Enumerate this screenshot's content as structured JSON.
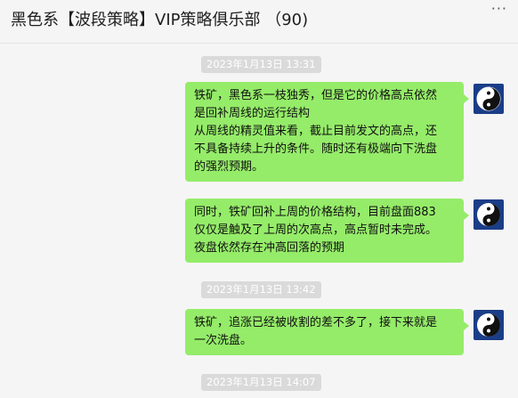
{
  "window": {
    "title": "黑色系【波段策略】VIP策略俱乐部 （90)",
    "more_label": "···"
  },
  "messages": [
    {
      "time": "2023年1月13日 13:31"
    },
    {
      "lines": [
        "铁矿，黑色系一枝独秀，但是它的价格高点依然",
        "是回补周线的运行结构",
        "从周线的精灵值来看，截止目前发文的高点，还",
        "不具备持续上升的条件。随时还有极端向下洗盘",
        "的强烈预期。"
      ]
    },
    {
      "lines": [
        "同时，铁矿回补上周的价格结构，目前盘面883",
        "仅仅是触及了上周的次高点，高点暂时未完成。",
        "夜盘依然存在冲高回落的预期"
      ]
    },
    {
      "time": "2023年1月13日 13:42"
    },
    {
      "lines": [
        "铁矿，追涨已经被收割的差不多了，接下来就是",
        "一次洗盘。"
      ]
    },
    {
      "time": "2023年1月13日 14:07"
    }
  ],
  "colors": {
    "bubble": "#95ec69",
    "avatar_bg": "#1a3d87",
    "timestamp_bg": "#dadada",
    "background": "#f5f5f5"
  },
  "icons": [
    "yin-yang-icon"
  ]
}
